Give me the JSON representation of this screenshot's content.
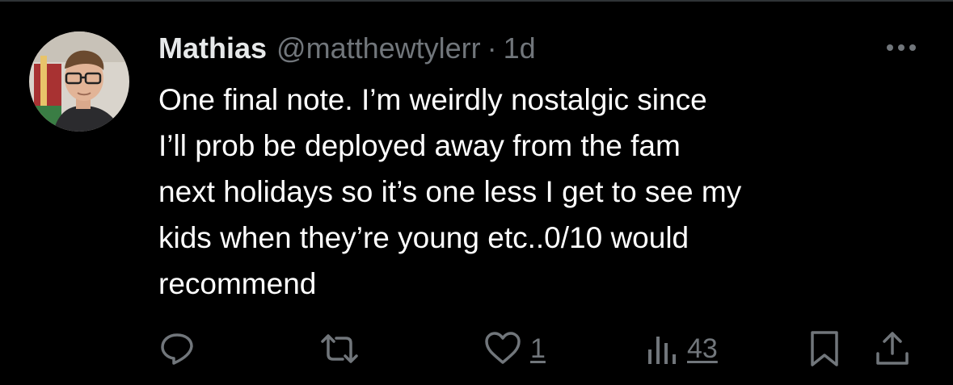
{
  "tweet": {
    "author_name": "Mathias",
    "author_handle": "@matthewtylerr",
    "separator": "·",
    "timestamp": "1d",
    "text": "One final note. I’m weirdly nostalgic since\nI’ll prob be deployed away from the fam\nnext holidays so it’s one less I get to see my\nkids when they’re young etc..0/10 would\nrecommend"
  },
  "actions": {
    "reply": {
      "icon": "reply-icon"
    },
    "retweet": {
      "icon": "retweet-icon"
    },
    "like": {
      "icon": "heart-icon",
      "count": "1"
    },
    "views": {
      "icon": "views-chart-icon",
      "count": "43"
    },
    "bookmark": {
      "icon": "bookmark-icon"
    },
    "share": {
      "icon": "share-icon"
    }
  },
  "colors": {
    "background": "#000000",
    "text_primary": "#e7e9ea",
    "text_secondary": "#71767b",
    "divider": "#2f3336"
  }
}
